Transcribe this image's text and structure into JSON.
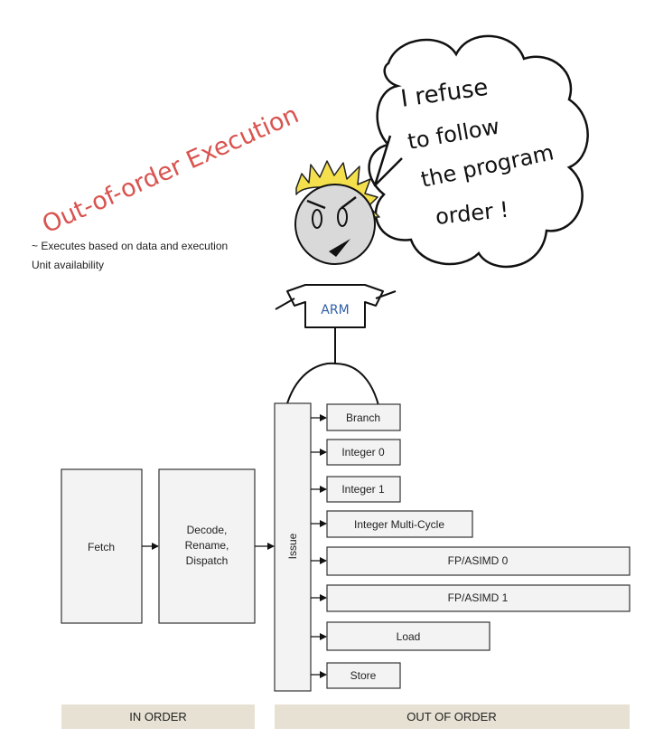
{
  "title": "Out-of-order Execution",
  "subtitle_line1": "~  Executes based on data and execution",
  "subtitle_line2": "Unit availability",
  "speech_bubble": [
    "I refuse",
    "to follow",
    "the program",
    "order !"
  ],
  "shirt_label": "ARM",
  "stages": {
    "fetch": "Fetch",
    "decode": [
      "Decode,",
      "Rename,",
      "Dispatch"
    ],
    "issue": "Issue"
  },
  "units": [
    "Branch",
    "Integer 0",
    "Integer 1",
    "Integer Multi-Cycle",
    "FP/ASIMD 0",
    "FP/ASIMD 1",
    "Load",
    "Store"
  ],
  "footer": {
    "in_order": "IN ORDER",
    "out_of_order": "OUT OF ORDER"
  },
  "colors": {
    "title_red": "#d9534f",
    "box_fill": "#f3f3f3",
    "box_stroke": "#333333",
    "footer_fill": "#e6e1d3",
    "face_fill": "#d9d9d9",
    "hair": "#f4e04d",
    "arm_blue": "#2f5fa8"
  }
}
